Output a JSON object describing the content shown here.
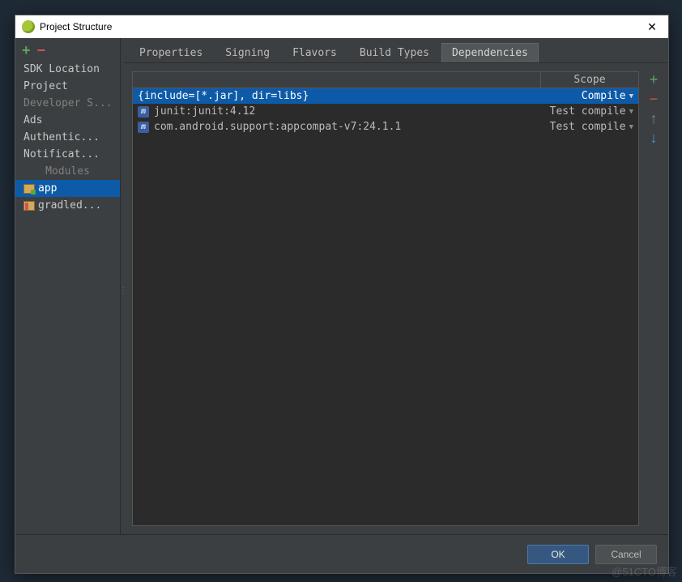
{
  "window": {
    "title": "Project Structure"
  },
  "sidebar": {
    "items": [
      {
        "label": "SDK Location",
        "dim": false
      },
      {
        "label": "Project",
        "dim": false
      },
      {
        "label": "Developer S...",
        "dim": true
      },
      {
        "label": "Ads",
        "dim": false
      },
      {
        "label": "Authentic...",
        "dim": false
      },
      {
        "label": "Notificat...",
        "dim": false
      }
    ],
    "modules_header": "Modules",
    "modules": [
      {
        "label": "app",
        "selected": true,
        "icon": "app"
      },
      {
        "label": "gradled...",
        "selected": false,
        "icon": "gradle"
      }
    ]
  },
  "tabs": [
    {
      "label": "Properties",
      "active": false
    },
    {
      "label": "Signing",
      "active": false
    },
    {
      "label": "Flavors",
      "active": false
    },
    {
      "label": "Build Types",
      "active": false
    },
    {
      "label": "Dependencies",
      "active": true
    }
  ],
  "table": {
    "scope_header": "Scope",
    "rows": [
      {
        "icon": "",
        "label": "{include=[*.jar], dir=libs}",
        "scope": "Compile",
        "selected": true
      },
      {
        "icon": "m",
        "label": "junit:junit:4.12",
        "scope": "Test compile",
        "selected": false
      },
      {
        "icon": "m",
        "label": "com.android.support:appcompat-v7:24.1.1",
        "scope": "Test compile",
        "selected": false
      }
    ]
  },
  "footer": {
    "ok": "OK",
    "cancel": "Cancel"
  },
  "watermark": "@51CTO博客"
}
